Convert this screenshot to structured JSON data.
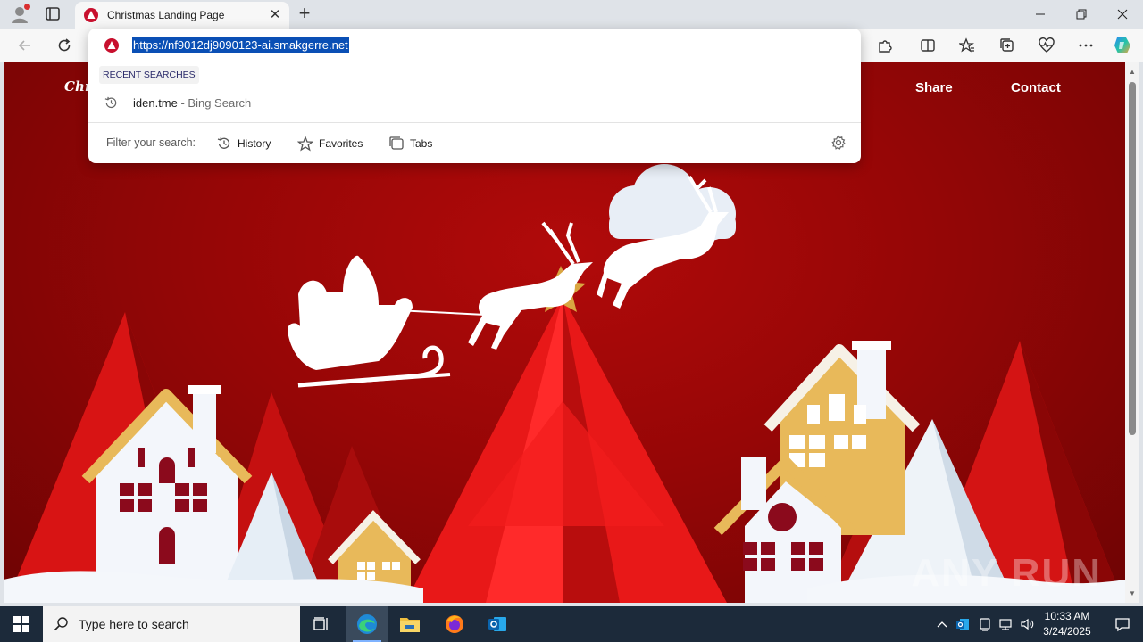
{
  "browser": {
    "tab_title": "Christmas Landing Page",
    "url_selected": "https://nf9012dj9090123-ai.smakgerre.net"
  },
  "omnibox": {
    "section_label": "RECENT SEARCHES",
    "suggestion_query": "iden.tme",
    "suggestion_source": " - Bing Search",
    "filter_label": "Filter your search:",
    "filters": [
      "History",
      "Favorites",
      "Tabs"
    ]
  },
  "page": {
    "brand": "Chri",
    "nav": [
      "Share",
      "Contact"
    ],
    "watermark": "ANY RUN"
  },
  "taskbar": {
    "search_placeholder": "Type here to search",
    "time": "10:33 AM",
    "date": "3/24/2025"
  },
  "colors": {
    "page_red": "#960606",
    "url_highlight": "#0a4fb5",
    "taskbar": "#1c2a3a"
  }
}
